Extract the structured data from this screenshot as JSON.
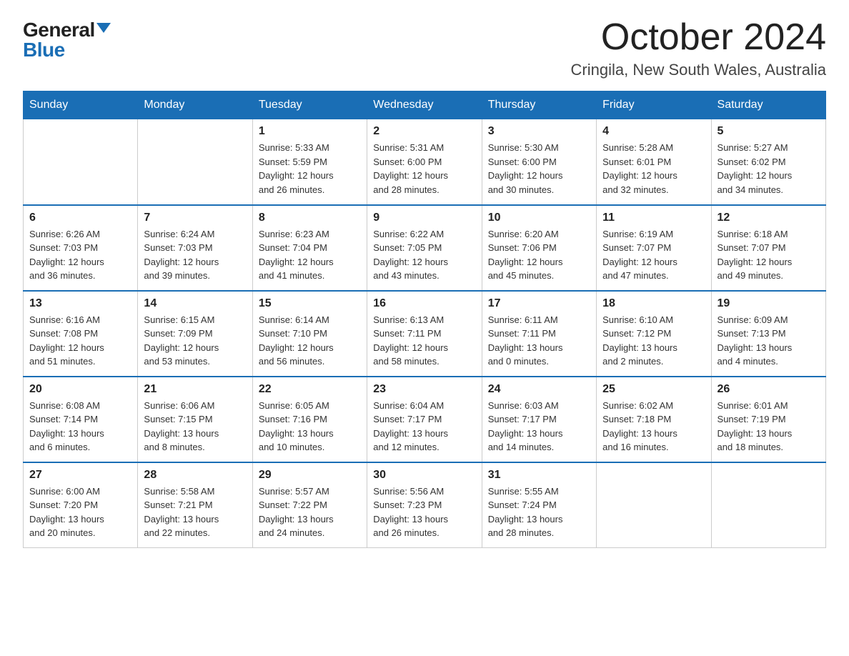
{
  "header": {
    "logo_general": "General",
    "logo_blue": "Blue",
    "month_title": "October 2024",
    "location": "Cringila, New South Wales, Australia"
  },
  "weekdays": [
    "Sunday",
    "Monday",
    "Tuesday",
    "Wednesday",
    "Thursday",
    "Friday",
    "Saturday"
  ],
  "weeks": [
    [
      {
        "day": "",
        "info": ""
      },
      {
        "day": "",
        "info": ""
      },
      {
        "day": "1",
        "info": "Sunrise: 5:33 AM\nSunset: 5:59 PM\nDaylight: 12 hours\nand 26 minutes."
      },
      {
        "day": "2",
        "info": "Sunrise: 5:31 AM\nSunset: 6:00 PM\nDaylight: 12 hours\nand 28 minutes."
      },
      {
        "day": "3",
        "info": "Sunrise: 5:30 AM\nSunset: 6:00 PM\nDaylight: 12 hours\nand 30 minutes."
      },
      {
        "day": "4",
        "info": "Sunrise: 5:28 AM\nSunset: 6:01 PM\nDaylight: 12 hours\nand 32 minutes."
      },
      {
        "day": "5",
        "info": "Sunrise: 5:27 AM\nSunset: 6:02 PM\nDaylight: 12 hours\nand 34 minutes."
      }
    ],
    [
      {
        "day": "6",
        "info": "Sunrise: 6:26 AM\nSunset: 7:03 PM\nDaylight: 12 hours\nand 36 minutes."
      },
      {
        "day": "7",
        "info": "Sunrise: 6:24 AM\nSunset: 7:03 PM\nDaylight: 12 hours\nand 39 minutes."
      },
      {
        "day": "8",
        "info": "Sunrise: 6:23 AM\nSunset: 7:04 PM\nDaylight: 12 hours\nand 41 minutes."
      },
      {
        "day": "9",
        "info": "Sunrise: 6:22 AM\nSunset: 7:05 PM\nDaylight: 12 hours\nand 43 minutes."
      },
      {
        "day": "10",
        "info": "Sunrise: 6:20 AM\nSunset: 7:06 PM\nDaylight: 12 hours\nand 45 minutes."
      },
      {
        "day": "11",
        "info": "Sunrise: 6:19 AM\nSunset: 7:07 PM\nDaylight: 12 hours\nand 47 minutes."
      },
      {
        "day": "12",
        "info": "Sunrise: 6:18 AM\nSunset: 7:07 PM\nDaylight: 12 hours\nand 49 minutes."
      }
    ],
    [
      {
        "day": "13",
        "info": "Sunrise: 6:16 AM\nSunset: 7:08 PM\nDaylight: 12 hours\nand 51 minutes."
      },
      {
        "day": "14",
        "info": "Sunrise: 6:15 AM\nSunset: 7:09 PM\nDaylight: 12 hours\nand 53 minutes."
      },
      {
        "day": "15",
        "info": "Sunrise: 6:14 AM\nSunset: 7:10 PM\nDaylight: 12 hours\nand 56 minutes."
      },
      {
        "day": "16",
        "info": "Sunrise: 6:13 AM\nSunset: 7:11 PM\nDaylight: 12 hours\nand 58 minutes."
      },
      {
        "day": "17",
        "info": "Sunrise: 6:11 AM\nSunset: 7:11 PM\nDaylight: 13 hours\nand 0 minutes."
      },
      {
        "day": "18",
        "info": "Sunrise: 6:10 AM\nSunset: 7:12 PM\nDaylight: 13 hours\nand 2 minutes."
      },
      {
        "day": "19",
        "info": "Sunrise: 6:09 AM\nSunset: 7:13 PM\nDaylight: 13 hours\nand 4 minutes."
      }
    ],
    [
      {
        "day": "20",
        "info": "Sunrise: 6:08 AM\nSunset: 7:14 PM\nDaylight: 13 hours\nand 6 minutes."
      },
      {
        "day": "21",
        "info": "Sunrise: 6:06 AM\nSunset: 7:15 PM\nDaylight: 13 hours\nand 8 minutes."
      },
      {
        "day": "22",
        "info": "Sunrise: 6:05 AM\nSunset: 7:16 PM\nDaylight: 13 hours\nand 10 minutes."
      },
      {
        "day": "23",
        "info": "Sunrise: 6:04 AM\nSunset: 7:17 PM\nDaylight: 13 hours\nand 12 minutes."
      },
      {
        "day": "24",
        "info": "Sunrise: 6:03 AM\nSunset: 7:17 PM\nDaylight: 13 hours\nand 14 minutes."
      },
      {
        "day": "25",
        "info": "Sunrise: 6:02 AM\nSunset: 7:18 PM\nDaylight: 13 hours\nand 16 minutes."
      },
      {
        "day": "26",
        "info": "Sunrise: 6:01 AM\nSunset: 7:19 PM\nDaylight: 13 hours\nand 18 minutes."
      }
    ],
    [
      {
        "day": "27",
        "info": "Sunrise: 6:00 AM\nSunset: 7:20 PM\nDaylight: 13 hours\nand 20 minutes."
      },
      {
        "day": "28",
        "info": "Sunrise: 5:58 AM\nSunset: 7:21 PM\nDaylight: 13 hours\nand 22 minutes."
      },
      {
        "day": "29",
        "info": "Sunrise: 5:57 AM\nSunset: 7:22 PM\nDaylight: 13 hours\nand 24 minutes."
      },
      {
        "day": "30",
        "info": "Sunrise: 5:56 AM\nSunset: 7:23 PM\nDaylight: 13 hours\nand 26 minutes."
      },
      {
        "day": "31",
        "info": "Sunrise: 5:55 AM\nSunset: 7:24 PM\nDaylight: 13 hours\nand 28 minutes."
      },
      {
        "day": "",
        "info": ""
      },
      {
        "day": "",
        "info": ""
      }
    ]
  ]
}
